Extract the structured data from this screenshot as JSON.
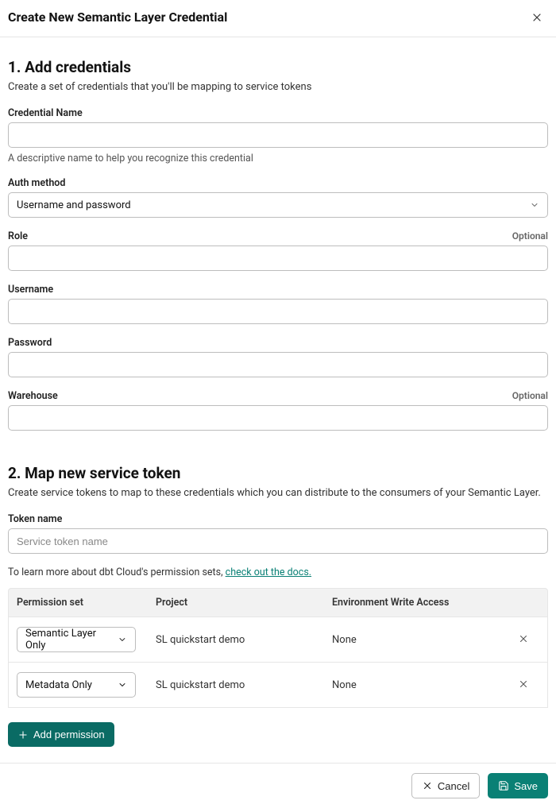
{
  "modal": {
    "title": "Create New Semantic Layer Credential"
  },
  "section1": {
    "title": "1. Add credentials",
    "desc": "Create a set of credentials that you'll be mapping to service tokens",
    "fields": {
      "credential_name": {
        "label": "Credential Name",
        "help": "A descriptive name to help you recognize this credential"
      },
      "auth_method": {
        "label": "Auth method",
        "value": "Username and password"
      },
      "role": {
        "label": "Role",
        "optional": "Optional"
      },
      "username": {
        "label": "Username"
      },
      "password": {
        "label": "Password"
      },
      "warehouse": {
        "label": "Warehouse",
        "optional": "Optional"
      }
    }
  },
  "section2": {
    "title": "2. Map new service token",
    "desc": "Create service tokens to map to these credentials which you can distribute to the consumers of your Semantic Layer.",
    "token_name": {
      "label": "Token name",
      "placeholder": "Service token name"
    },
    "docs_prefix": "To learn more about dbt Cloud's permission sets, ",
    "docs_link": "check out the docs.",
    "table": {
      "headers": {
        "perm": "Permission set",
        "proj": "Project",
        "env": "Environment Write Access"
      },
      "rows": [
        {
          "perm": "Semantic Layer Only",
          "proj": "SL quickstart demo",
          "env": "None"
        },
        {
          "perm": "Metadata Only",
          "proj": "SL quickstart demo",
          "env": "None"
        }
      ]
    },
    "add_permission": "Add permission"
  },
  "footer": {
    "cancel": "Cancel",
    "save": "Save"
  }
}
